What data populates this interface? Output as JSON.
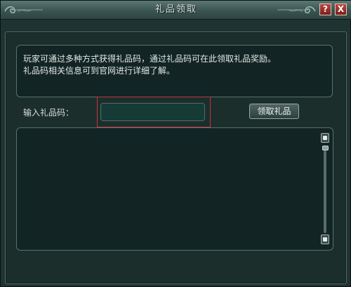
{
  "window": {
    "title": "礼品领取",
    "help_label": "?",
    "close_label": "X"
  },
  "info": {
    "line1": "玩家可通过多种方式获得礼品码，通过礼品码可在此领取礼品奖励。",
    "line2": "礼品码相关信息可到官网进行详细了解。"
  },
  "code_entry": {
    "label": "输入礼品码：",
    "value": "",
    "claim_button": "领取礼品"
  },
  "result": {
    "text": ""
  },
  "icons": {
    "title_ornament": "cloud-ornament",
    "help": "question-mark",
    "close": "x-mark",
    "scroll_up": "arrow-up",
    "scroll_down": "arrow-down"
  },
  "colors": {
    "panel_bg": "#122524",
    "panel_border": "#58726e",
    "highlight": "#c4353b",
    "title_button": "#9a2e26"
  }
}
